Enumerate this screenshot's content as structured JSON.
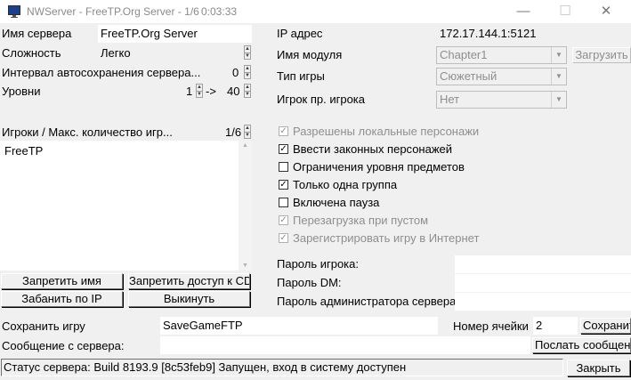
{
  "window": {
    "title": "NWServer - FreeTP.Org Server - 1/6",
    "timer": "0:03:33",
    "minimize_glyph": "—",
    "maximize_glyph": "☐",
    "close_glyph": "✕"
  },
  "left": {
    "server_name_label": "Имя сервера",
    "server_name_value": "FreeTP.Org Server",
    "difficulty_label": "Сложность",
    "difficulty_value": "Легко",
    "autosave_label": "Интервал автосохранения сервера...",
    "autosave_value": "0",
    "levels_label": "Уровни",
    "levels_min": "1",
    "levels_arrow": "->",
    "levels_max": "40",
    "players_label": "Игроки / Макс. количество игр...",
    "players_value": "1/6",
    "players_list": [
      "FreeTP"
    ],
    "buttons": {
      "ban_name": "Запретить имя",
      "ban_cd": "Запретить доступ к CD",
      "ban_ip": "Забанить по IP",
      "kick": "Выкинуть"
    }
  },
  "right": {
    "ip_label": "IP адрес",
    "ip_value": "172.17.144.1:5121",
    "module_label": "Имя модуля",
    "module_value": "Chapter1",
    "load_button": "Загрузить",
    "game_type_label": "Тип игры",
    "game_type_value": "Сюжетный",
    "pvp_label": "Игрок пр. игрока",
    "pvp_value": "Нет",
    "options": [
      {
        "label": "Разрешены локальные персонажи",
        "checked": true,
        "enabled": false
      },
      {
        "label": "Ввести законных персонажей",
        "checked": true,
        "enabled": true
      },
      {
        "label": "Ограничения уровня предметов",
        "checked": false,
        "enabled": true
      },
      {
        "label": "Только одна группа",
        "checked": true,
        "enabled": true
      },
      {
        "label": "Включена пауза",
        "checked": false,
        "enabled": true
      },
      {
        "label": "Перезагрузка при пустом",
        "checked": true,
        "enabled": false
      },
      {
        "label": "Зарегистрировать игру в Интернет",
        "checked": true,
        "enabled": false
      }
    ],
    "player_password_label": "Пароль игрока:",
    "dm_password_label": "Пароль DM:",
    "admin_password_label": "Пароль администратора сервера"
  },
  "bottom": {
    "save_label": "Сохранить игру",
    "save_value": "SaveGameFTP",
    "slot_label": "Номер ячейки",
    "slot_value": "2",
    "save_button": "Сохранить",
    "message_label": "Сообщение с сервера:",
    "message_value": "",
    "send_button": "Послать сообщение",
    "status_text": "Статус сервера: Build 8193.9 [8c53feb9] Запущен, вход в систему доступен",
    "close_button": "Закрыть"
  }
}
